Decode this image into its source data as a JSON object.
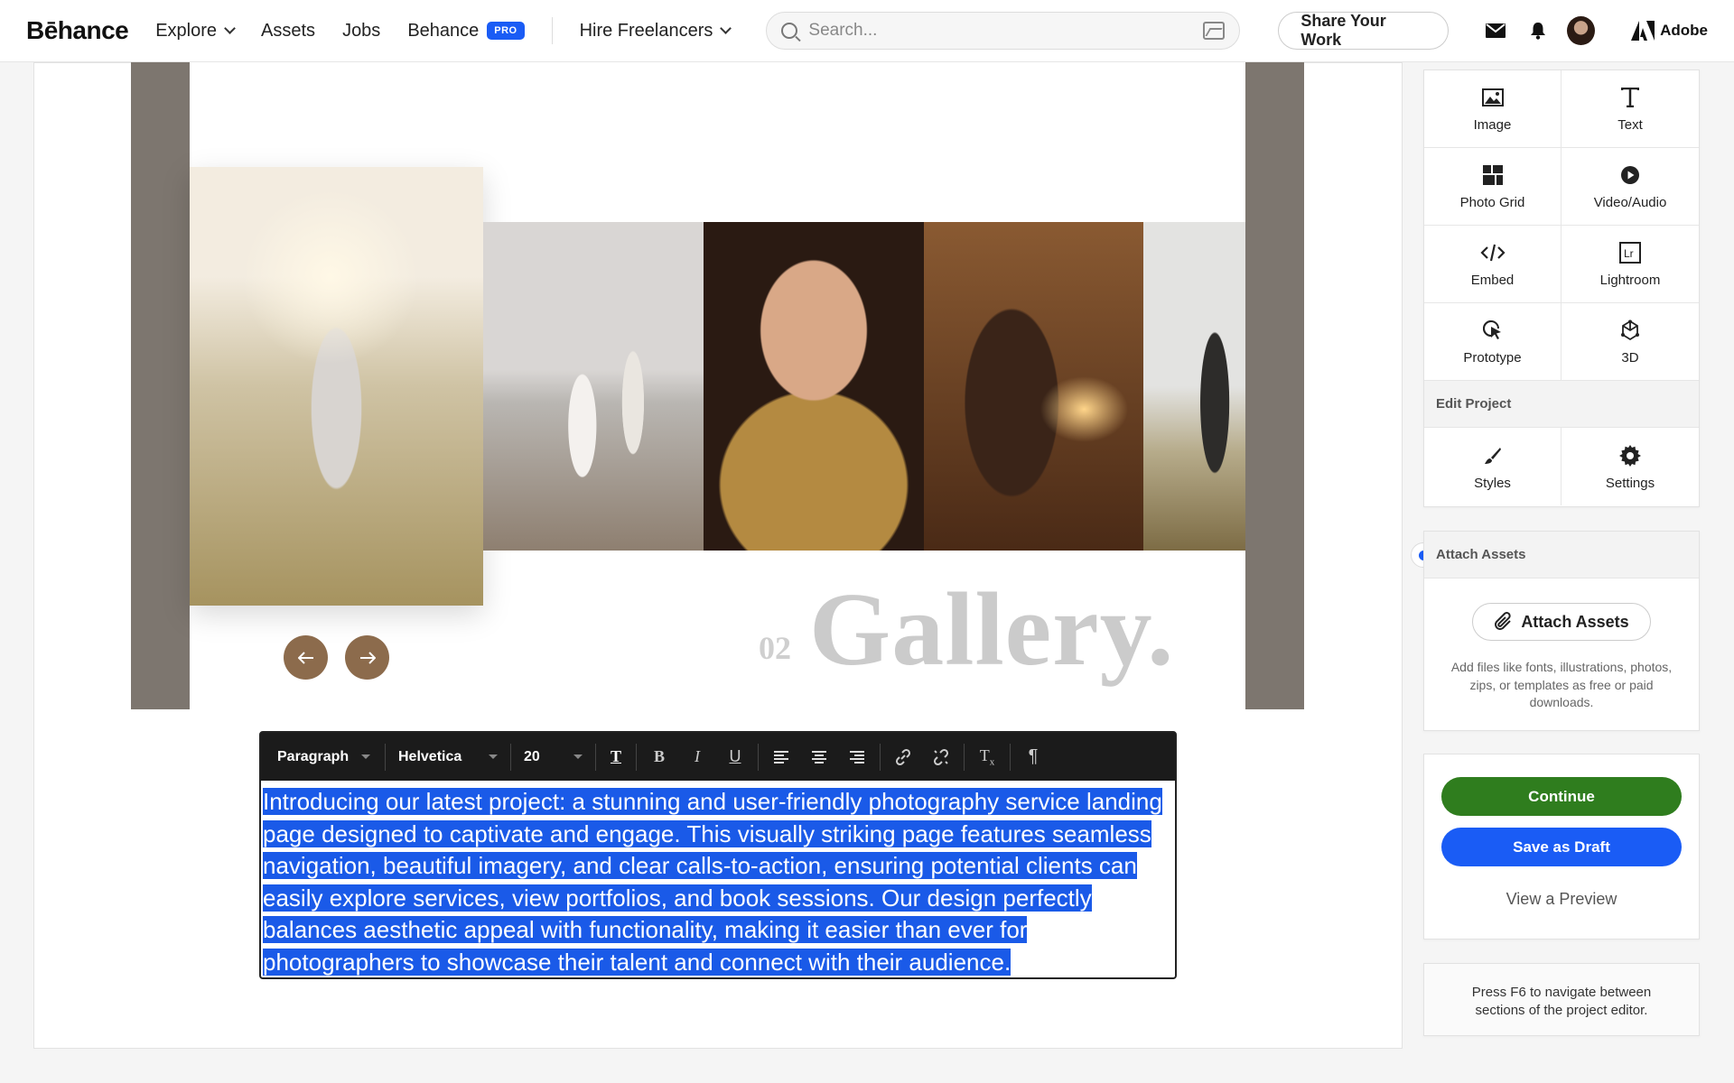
{
  "nav": {
    "logo": "Bēhance",
    "explore": "Explore",
    "assets": "Assets",
    "jobs": "Jobs",
    "behance": "Behance",
    "pro_badge": "PRO",
    "hire": "Hire Freelancers",
    "search_placeholder": "Search...",
    "share": "Share Your Work",
    "adobe": "Adobe"
  },
  "canvas": {
    "gallery_number": "02",
    "gallery_title": "Gallery.",
    "photos": [
      {
        "name": "maternity-photo",
        "desc_icon": "image"
      },
      {
        "name": "beach-couple-photo",
        "desc_icon": "image"
      },
      {
        "name": "newborn-photo",
        "desc_icon": "image"
      },
      {
        "name": "party-photo",
        "desc_icon": "image"
      },
      {
        "name": "groom-photo",
        "desc_icon": "image"
      }
    ]
  },
  "editor": {
    "block_type": "Paragraph",
    "font": "Helvetica",
    "size": "20",
    "text": "Introducing our latest project: a stunning and user-friendly photography service landing page designed to captivate and engage. This visually striking page features seamless navigation, beautiful imagery, and clear calls-to-action, ensuring potential clients can easily explore services, view portfolios, and book sessions. Our design perfectly balances aesthetic appeal with functionality, making it easier than ever for photographers to showcase their talent and connect with their audience."
  },
  "panel": {
    "tools": [
      {
        "label": "Image",
        "icon": "image-icon"
      },
      {
        "label": "Text",
        "icon": "text-icon"
      },
      {
        "label": "Photo Grid",
        "icon": "photo-grid-icon"
      },
      {
        "label": "Video/Audio",
        "icon": "play-icon"
      },
      {
        "label": "Embed",
        "icon": "code-icon"
      },
      {
        "label": "Lightroom",
        "icon": "lightroom-icon"
      },
      {
        "label": "Prototype",
        "icon": "prototype-icon"
      },
      {
        "label": "3D",
        "icon": "3d-icon"
      }
    ],
    "edit_project": "Edit Project",
    "styles": "Styles",
    "settings": "Settings",
    "attach_header": "Attach Assets",
    "attach_button": "Attach Assets",
    "attach_desc": "Add files like fonts, illustrations, photos, zips, or templates as free or paid downloads.",
    "continue": "Continue",
    "save_draft": "Save as Draft",
    "preview": "View a Preview",
    "hint": "Press F6 to navigate between sections of the project editor."
  }
}
